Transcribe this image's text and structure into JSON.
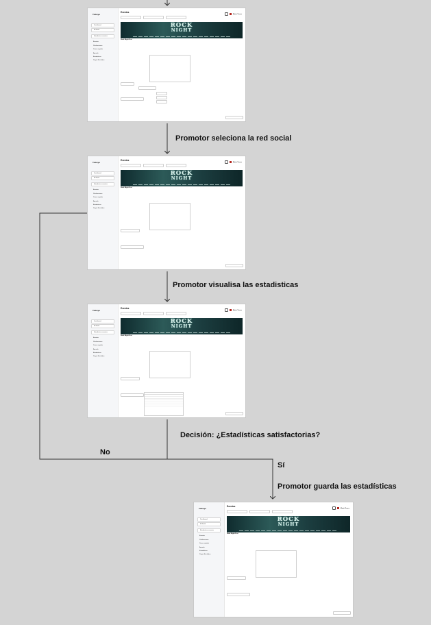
{
  "diagram": {
    "steps": [
      "Promotor seleciona la red social",
      "Promotor  visualisa las estadisticas",
      "Decisión: ¿Estadísticas satisfactorias?",
      "Promotor guarda las estadísticas"
    ],
    "branches": {
      "no": "No",
      "yes": "Sí"
    }
  },
  "screen": {
    "brand": "Tickeyo",
    "title": "Eventos",
    "user_name": "Mario Torres",
    "banner": {
      "line1": "ROCK",
      "line2": "NIGHT"
    },
    "nav": [
      "Dashboard",
      "Mi Perfil",
      "Estadisticas eventos",
      "Eventos",
      "Publicaciones",
      "Dinero vigiado",
      "Agenda",
      "Estadisticas",
      "Pagos Recibidos"
    ],
    "event_name": "Rock Night Fest"
  },
  "colors": {
    "background": "#d4d4d4",
    "screen_bg": "#ffffff",
    "sidebar_bg": "#f5f6f8",
    "banner_dark": "#0f2b2e",
    "banner_light": "#2c5a58",
    "avatar": "#b3261e",
    "line": "#333333"
  }
}
